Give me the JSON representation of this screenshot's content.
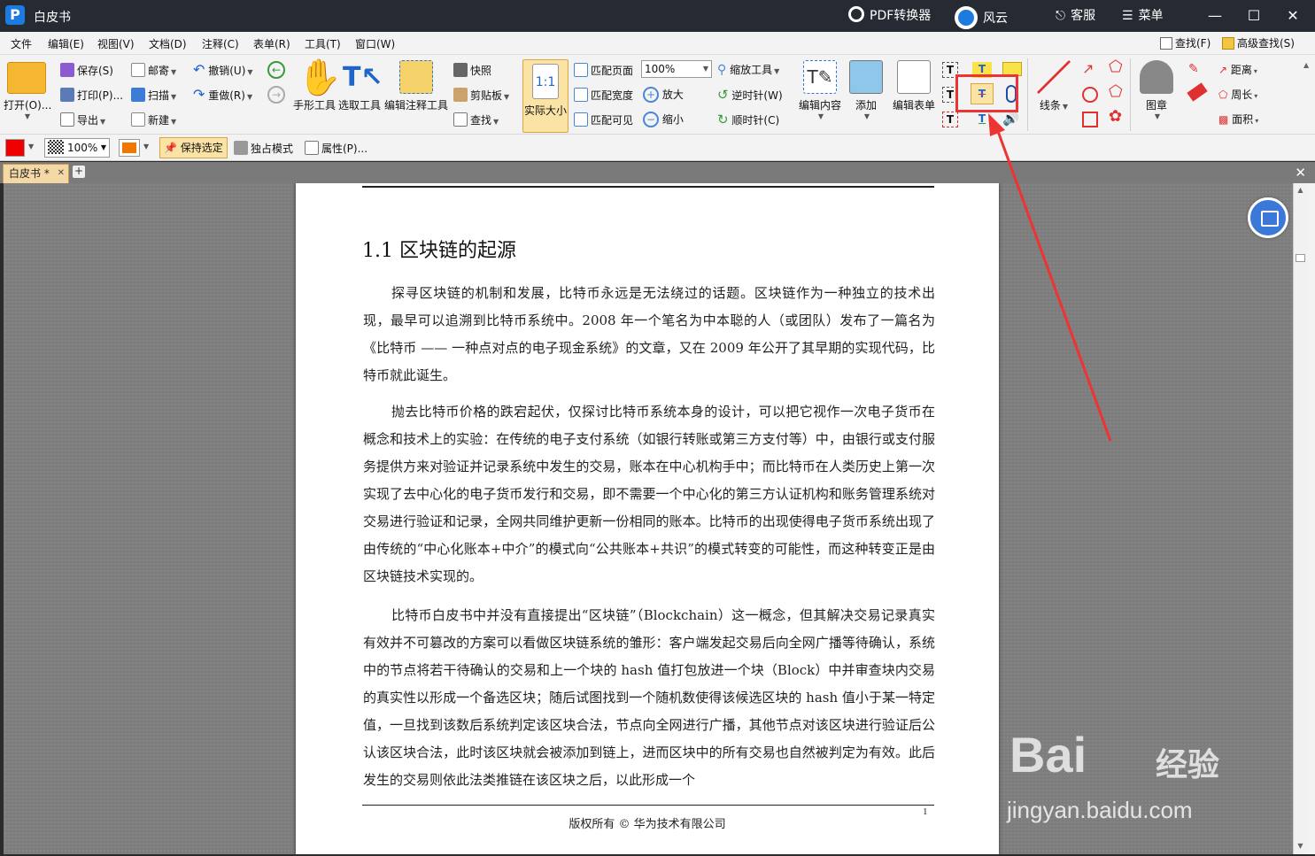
{
  "titlebar": {
    "app_name": "白皮书",
    "pdf_converter": "PDF转换器",
    "user": "风云",
    "service": "客服",
    "menu": "菜单"
  },
  "menubar": {
    "items": [
      "文件",
      "编辑(E)",
      "视图(V)",
      "文档(D)",
      "注释(C)",
      "表单(R)",
      "工具(T)",
      "窗口(W)"
    ],
    "find": "查找(F)",
    "advanced_find": "高级查找(S)"
  },
  "ribbon": {
    "open": "打开(O)...",
    "save": "保存(S)",
    "print": "打印(P)...",
    "export": "导出",
    "mail": "邮寄",
    "scan": "扫描",
    "new": "新建",
    "undo": "撤销(U)",
    "redo": "重做(R)",
    "hand_tool": "手形工具",
    "select_text": "选取工具",
    "edit_annot": "编辑注释工具",
    "snapshot": "快照",
    "clipboard": "剪贴板",
    "find": "查找",
    "actual_size": "实际大小",
    "fit_page": "匹配页面",
    "fit_width": "匹配宽度",
    "fit_visible": "匹配可见",
    "zoom_value": "100%",
    "zoom_in": "放大",
    "zoom_out": "缩小",
    "zoom_tool": "缩放工具",
    "rotate_ccw": "逆时针(W)",
    "rotate_cw": "顺时针(C)",
    "edit_content": "编辑内容",
    "add": "添加",
    "edit_form": "编辑表单",
    "lines": "线条",
    "stamp": "图章",
    "distance": "距离",
    "perimeter": "周长",
    "area": "面积"
  },
  "toolbar2": {
    "opacity": "100%",
    "keep_selected": "保持选定",
    "exclusive_mode": "独占模式",
    "properties": "属性(P)..."
  },
  "colors": {
    "fill": "#ee0000",
    "stroke": "#f07800",
    "highlight": "#ee3333"
  },
  "tab": {
    "title": "白皮书 *"
  },
  "document": {
    "heading": "1.1 区块链的起源",
    "paragraphs": [
      "探寻区块链的机制和发展，比特币永远是无法绕过的话题。区块链作为一种独立的技术出现，最早可以追溯到比特币系统中。2008 年一个笔名为中本聪的人（或团队）发布了一篇名为《比特币 —— 一种点对点的电子现金系统》的文章，又在 2009 年公开了其早期的实现代码，比特币就此诞生。",
      "抛去比特币价格的跌宕起伏，仅探讨比特币系统本身的设计，可以把它视作一次电子货币在概念和技术上的实验：在传统的电子支付系统（如银行转账或第三方支付等）中，由银行或支付服务提供方来对验证并记录系统中发生的交易，账本在中心机构手中；而比特币在人类历史上第一次实现了去中心化的电子货币发行和交易，即不需要一个中心化的第三方认证机构和账务管理系统对交易进行验证和记录，全网共同维护更新一份相同的账本。比特币的出现使得电子货币系统出现了由传统的“中心化账本+中介”的模式向“公共账本+共识”的模式转变的可能性，而这种转变正是由区块链技术实现的。",
      "比特币白皮书中并没有直接提出“区块链”（Blockchain）这一概念，但其解决交易记录真实有效并不可篡改的方案可以看做区块链系统的雏形：客户端发起交易后向全网广播等待确认，系统中的节点将若干待确认的交易和上一个块的 hash 值打包放进一个块（Block）中并审查块内交易的真实性以形成一个备选区块；随后试图找到一个随机数使得该候选区块的 hash 值小于某一特定值，一旦找到该数后系统判定该区块合法，节点向全网进行广播，其他节点对该区块进行验证后公认该区块合法，此时该区块就会被添加到链上，进而区块中的所有交易也自然被判定为有效。此后发生的交易则依此法类推链在该区块之后，以此形成一个"
    ],
    "page_number": "1",
    "footer": "版权所有 © 华为技术有限公司"
  },
  "watermark": {
    "brand": "Bai",
    "brand2": "经验",
    "url": "jingyan.baidu.com"
  }
}
